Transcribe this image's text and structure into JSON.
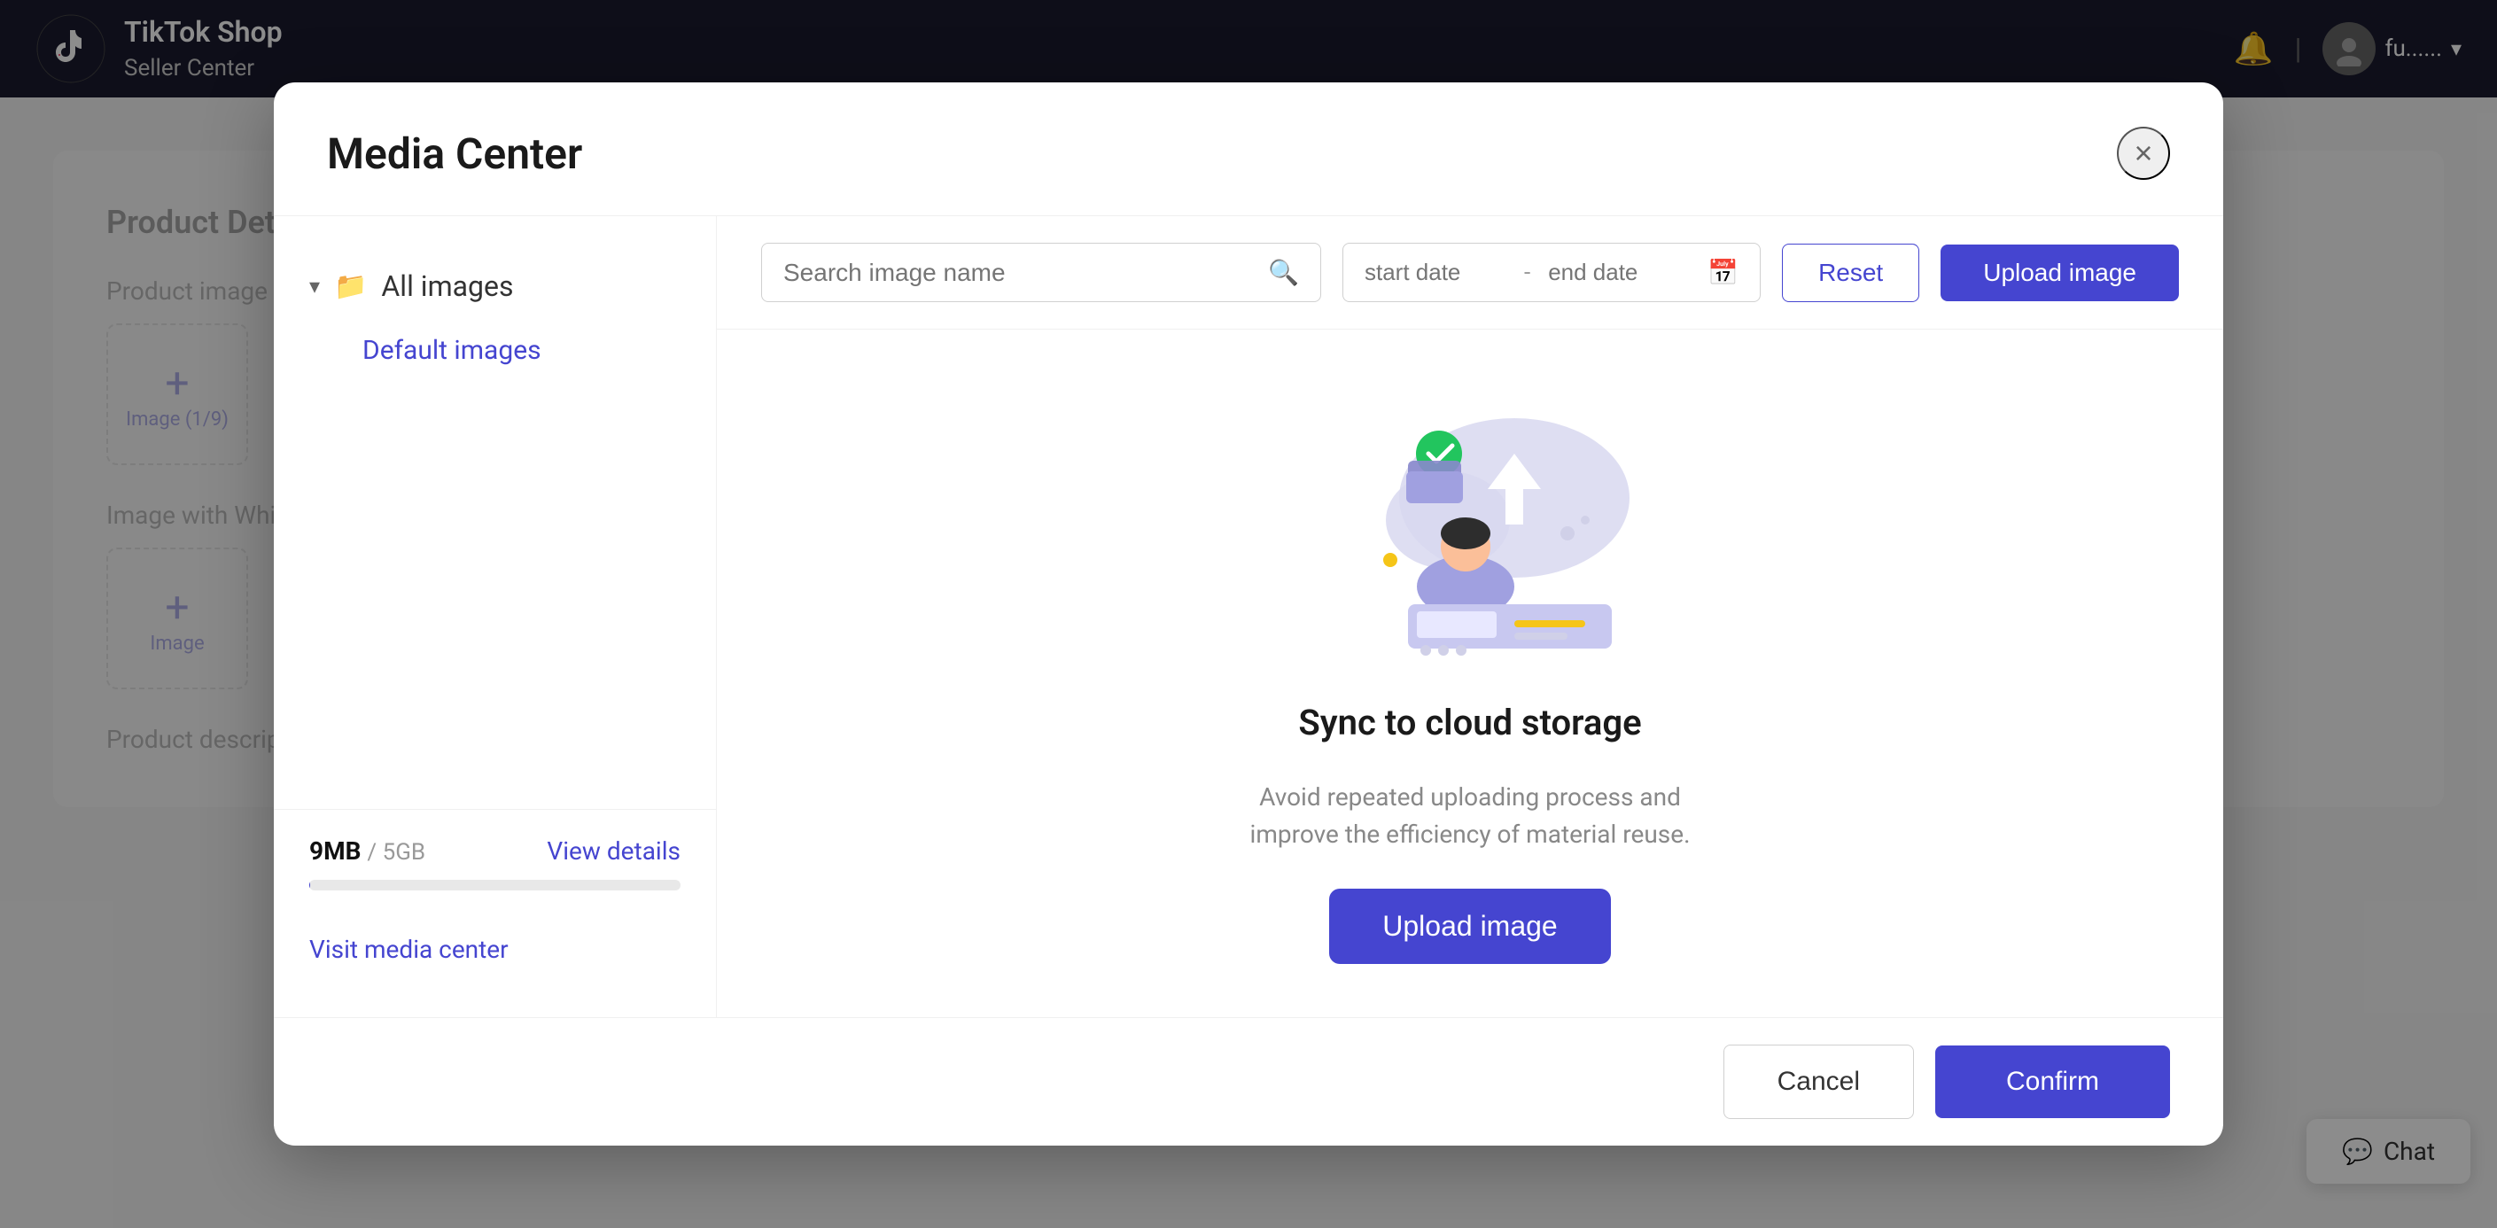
{
  "app": {
    "name": "TikTok Shop",
    "subtitle": "Seller Center"
  },
  "header": {
    "notification_icon": "🔔",
    "separator": "|",
    "user_name": "fu......",
    "chevron": "▾"
  },
  "background": {
    "product_details_label": "Product Details",
    "product_image_label": "Product image",
    "image_count_label": "Image (1/9)",
    "image_white_bg_label": "Image with White B",
    "image_label": "Image",
    "product_description_label": "Product description"
  },
  "chat_button": {
    "icon": "💬",
    "label": "Chat"
  },
  "modal": {
    "title": "Media Center",
    "close_icon": "×",
    "sidebar": {
      "all_images_label": "All images",
      "default_images_label": "Default images",
      "storage_used": "9MB",
      "storage_separator": "/",
      "storage_total": "5GB",
      "view_details_label": "View details",
      "storage_percent": 0.18,
      "visit_media_center_label": "Visit media center"
    },
    "toolbar": {
      "search_placeholder": "Search image name",
      "start_date_placeholder": "start date",
      "end_date_placeholder": "end date",
      "reset_label": "Reset",
      "upload_label": "Upload image"
    },
    "empty_state": {
      "title": "Sync to cloud storage",
      "subtitle_line1": "Avoid repeated uploading process and",
      "subtitle_line2": "improve the efficiency of material reuse.",
      "upload_label": "Upload image"
    },
    "footer": {
      "cancel_label": "Cancel",
      "confirm_label": "Confirm"
    }
  },
  "colors": {
    "brand_purple": "#4545d0",
    "header_dark": "#1a1a2e",
    "text_primary": "#1a1a1a",
    "text_secondary": "#888888",
    "border": "#d0d0d0"
  }
}
